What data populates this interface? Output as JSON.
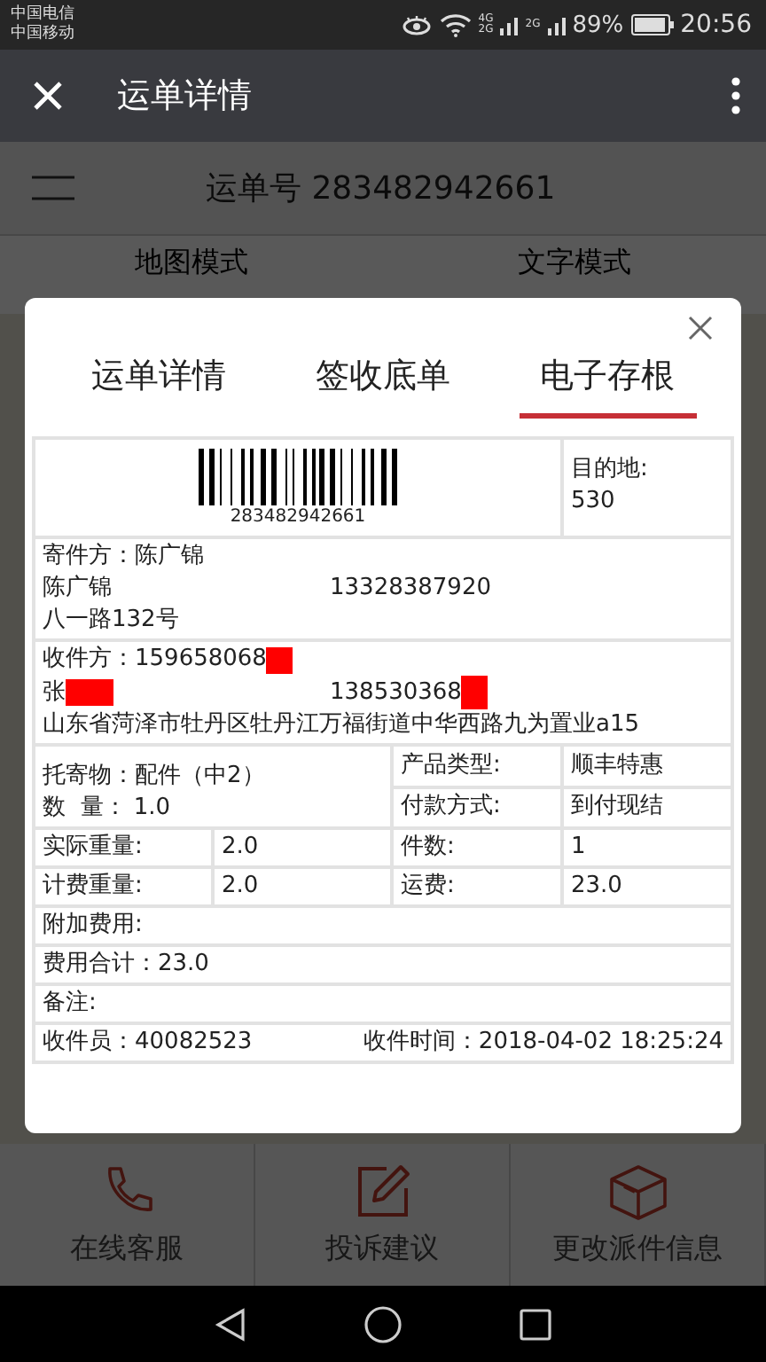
{
  "status_bar": {
    "carriers": [
      "中国电信",
      "中国移动"
    ],
    "network_labels": [
      "4G",
      "2G",
      "2G"
    ],
    "battery": "89%",
    "time": "20:56"
  },
  "app_bar": {
    "title": "运单详情"
  },
  "page": {
    "waybill_title": "运单号 283482942661",
    "view_tabs": [
      "地图模式",
      "文字模式"
    ]
  },
  "modal": {
    "tabs": [
      {
        "label": "运单详情",
        "selected": false
      },
      {
        "label": "签收底单",
        "selected": false
      },
      {
        "label": "电子存根",
        "selected": true
      }
    ],
    "receipt": {
      "barcode_number": "283482942661",
      "destination_label": "目的地:",
      "destination": "530",
      "sender": {
        "title": "寄件方：陈广锦",
        "name": "陈广锦",
        "phone": "13328387920",
        "address": "八一路132号"
      },
      "receiver": {
        "title": "收件方：159658068",
        "title_redacted": true,
        "name": "张",
        "name_redacted": true,
        "phone": "138530368",
        "phone_redacted": true,
        "address": "山东省菏泽市牡丹区牡丹江万福街道中华西路九为置业a15"
      },
      "cargo": "托寄物：配件（中2）",
      "quantity": "数  量： 1.0",
      "product_label": "产品类型:",
      "product": "顺丰特惠",
      "payment_label": "付款方式:",
      "payment": "到付现结",
      "weights": [
        {
          "label": "实际重量:",
          "value": "2.0",
          "label2": "件数:",
          "value2": "1"
        },
        {
          "label": "计费重量:",
          "value": "2.0",
          "label2": "运费:",
          "value2": "23.0"
        }
      ],
      "extra_fee": "附加费用:",
      "total": "费用合计：23.0",
      "remark": "备注:",
      "courier": "收件员：40082523",
      "pickup_time": "收件时间：2018-04-02 18:25:24"
    }
  },
  "bottom_actions": [
    {
      "kind": "phone",
      "label": "在线客服"
    },
    {
      "kind": "edit",
      "label": "投诉建议"
    },
    {
      "kind": "box",
      "label": "更改派件信息"
    }
  ]
}
